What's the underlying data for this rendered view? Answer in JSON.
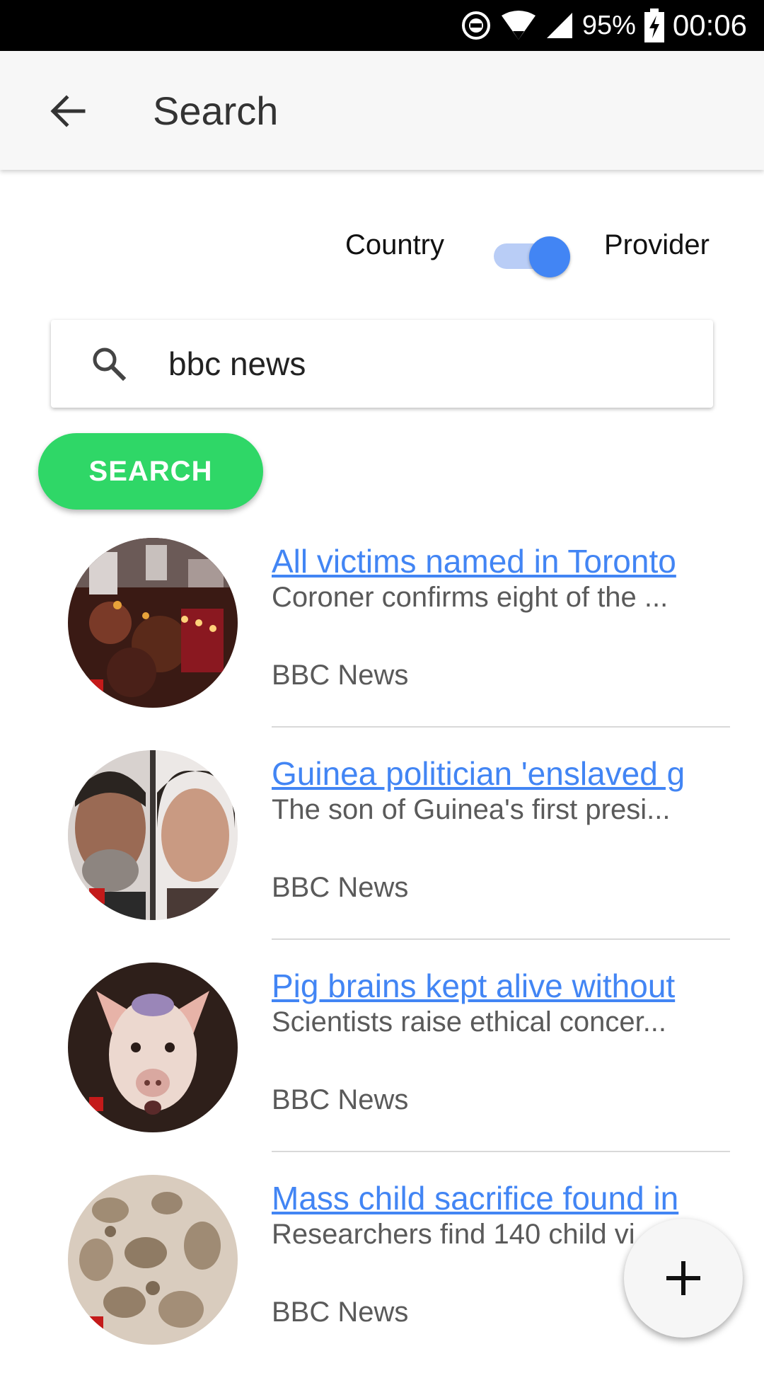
{
  "status_bar": {
    "battery": "95%",
    "time": "00:06",
    "icons": [
      "dnd-icon",
      "wifi-icon",
      "signal-icon",
      "battery-charging-icon"
    ]
  },
  "app_bar": {
    "title": "Search",
    "back_icon": "arrow-back-icon"
  },
  "filter_toggle": {
    "left_label": "Country",
    "right_label": "Provider",
    "state": "Provider",
    "accent_color": "#4285f4"
  },
  "search": {
    "value": "bbc news",
    "icon": "search-icon",
    "button_label": "SEARCH",
    "button_color": "#2fd767"
  },
  "results": [
    {
      "title": "All victims named in Toronto",
      "description": "Coroner confirms eight of the ...",
      "source": "BBC News",
      "thumbnail": "memorial-photo"
    },
    {
      "title": "Guinea politician 'enslaved g",
      "description": "The son of Guinea's first presi...",
      "source": "BBC News",
      "thumbnail": "portraits-photo"
    },
    {
      "title": "Pig brains kept alive without",
      "description": "Scientists raise ethical concer...",
      "source": "BBC News",
      "thumbnail": "pig-photo"
    },
    {
      "title": "Mass child sacrifice found in",
      "description": "Researchers find 140 child vi",
      "source": "BBC News",
      "thumbnail": "excavation-photo"
    }
  ],
  "fab": {
    "icon": "plus-icon"
  },
  "link_color": "#4285f4"
}
